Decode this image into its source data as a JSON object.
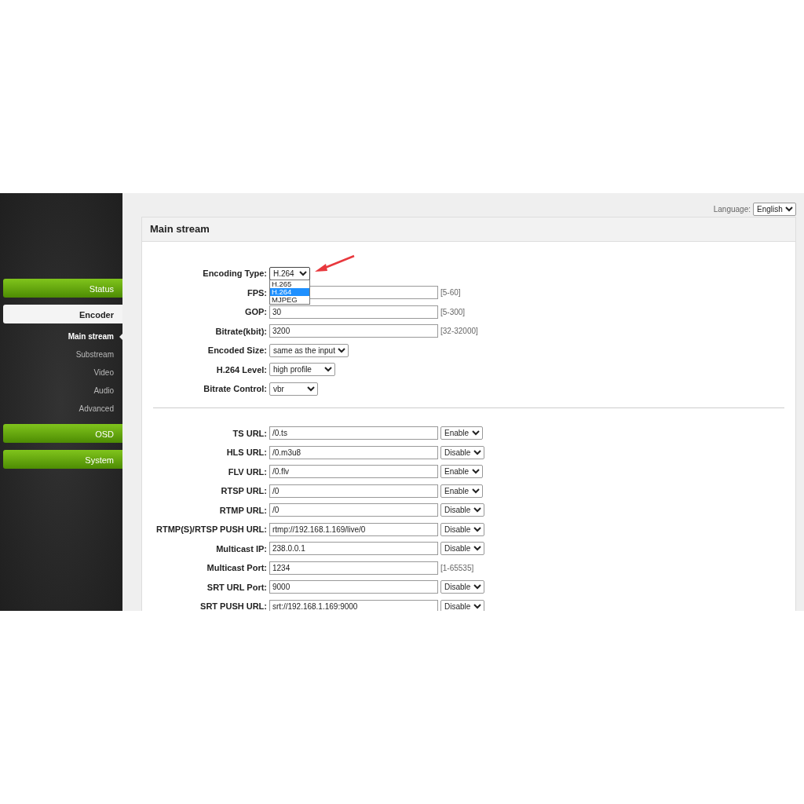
{
  "sidebar": {
    "items": [
      {
        "label": "Status",
        "selected": false
      },
      {
        "label": "Encoder",
        "selected": true,
        "children": [
          {
            "label": "Main stream",
            "selected": true
          },
          {
            "label": "Substream",
            "selected": false
          },
          {
            "label": "Video",
            "selected": false
          },
          {
            "label": "Audio",
            "selected": false
          },
          {
            "label": "Advanced",
            "selected": false
          }
        ]
      },
      {
        "label": "OSD",
        "selected": false
      },
      {
        "label": "System",
        "selected": false
      }
    ]
  },
  "language": {
    "label": "Language:",
    "value": "English"
  },
  "panel": {
    "title": "Main stream",
    "sections": [
      [
        {
          "kind": "select",
          "label": "Encoding Type:",
          "value": "H.264",
          "open": true,
          "options": [
            {
              "label": "H.265",
              "selected": false
            },
            {
              "label": "H.264",
              "selected": true
            },
            {
              "label": "MJPEG",
              "selected": false
            }
          ]
        },
        {
          "kind": "text",
          "label": "FPS:",
          "hint": "[5-60]"
        },
        {
          "kind": "text",
          "label": "GOP:",
          "value": "30",
          "hint": "[5-300]"
        },
        {
          "kind": "text",
          "label": "Bitrate(kbit):",
          "value": "3200",
          "hint": "[32-32000]"
        },
        {
          "kind": "select",
          "label": "Encoded Size:",
          "value": "same as the input",
          "open": false
        },
        {
          "kind": "select",
          "label": "H.264 Level:",
          "value": "high profile",
          "open": false
        },
        {
          "kind": "select",
          "label": "Bitrate Control:",
          "value": "vbr",
          "open": false
        }
      ],
      [
        {
          "kind": "toggle",
          "label": "TS URL:",
          "value": "/0.ts",
          "toggle": "Enable"
        },
        {
          "kind": "toggle",
          "label": "HLS URL:",
          "value": "/0.m3u8",
          "toggle": "Disable"
        },
        {
          "kind": "toggle",
          "label": "FLV URL:",
          "value": "/0.flv",
          "toggle": "Enable"
        },
        {
          "kind": "toggle",
          "label": "RTSP URL:",
          "value": "/0",
          "toggle": "Enable"
        },
        {
          "kind": "toggle",
          "label": "RTMP URL:",
          "value": "/0",
          "toggle": "Disable"
        },
        {
          "kind": "toggle",
          "label": "RTMP(S)/RTSP PUSH URL:",
          "value": "rtmp://192.168.1.169/live/0",
          "toggle": "Disable"
        },
        {
          "kind": "toggle",
          "label": "Multicast IP:",
          "value": "238.0.0.1",
          "toggle": "Disable"
        },
        {
          "kind": "text",
          "label": "Multicast Port:",
          "value": "1234",
          "hint": "[1-65535]"
        },
        {
          "kind": "toggle",
          "label": "SRT URL Port:",
          "value": "9000",
          "toggle": "Disable"
        },
        {
          "kind": "toggle",
          "label": "SRT PUSH URL:",
          "value": "srt://192.168.1.169:9000",
          "toggle": "Disable"
        }
      ]
    ]
  }
}
